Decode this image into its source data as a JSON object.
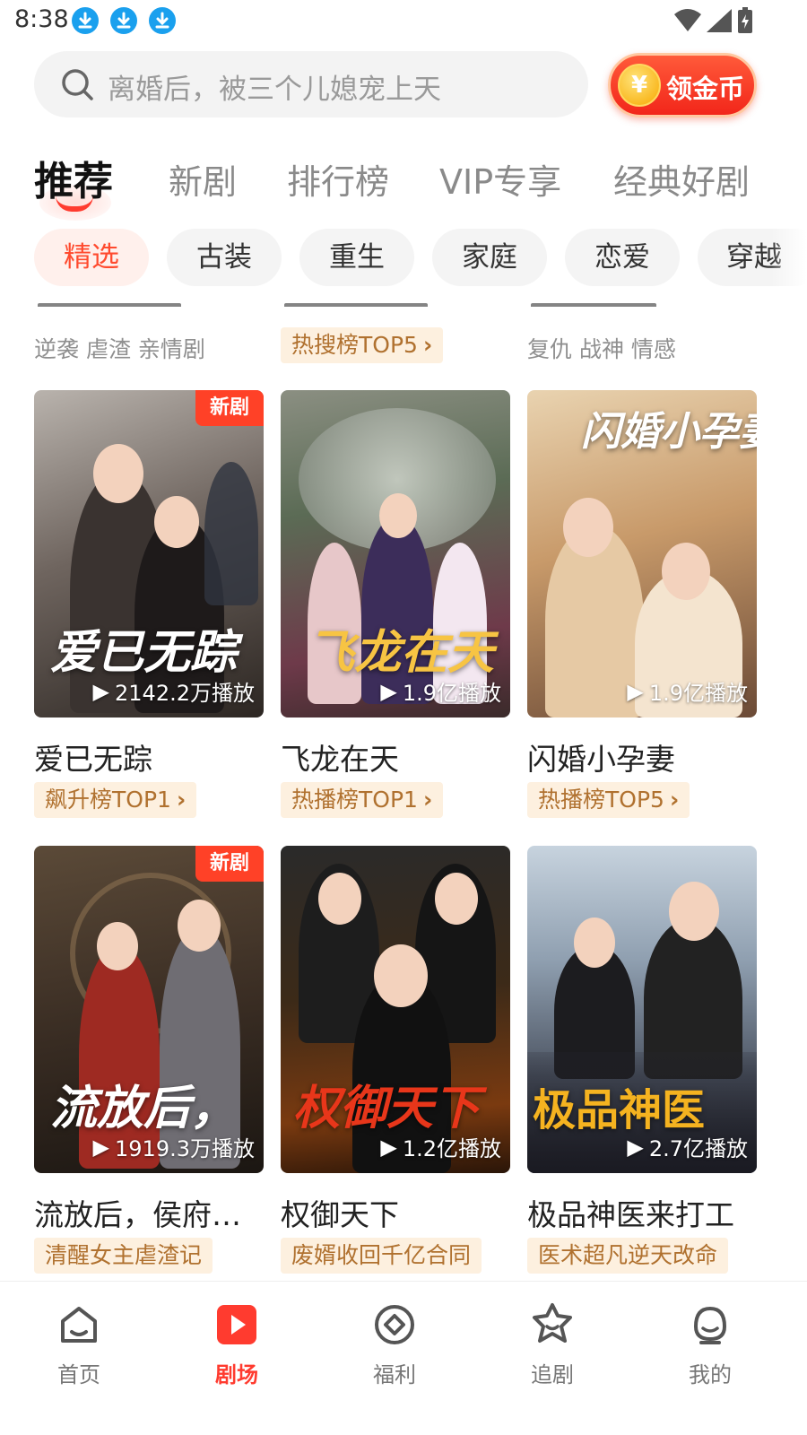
{
  "status_bar": {
    "time": "8:38"
  },
  "search": {
    "placeholder": "离婚后，被三个儿媳宠上天",
    "coin_button_label": "领金币",
    "coin_symbol": "¥"
  },
  "main_tabs": [
    {
      "label": "推荐",
      "active": true
    },
    {
      "label": "新剧"
    },
    {
      "label": "排行榜"
    },
    {
      "label": "VIP专享"
    },
    {
      "label": "经典好剧"
    }
  ],
  "chips": [
    {
      "label": "精选",
      "active": true
    },
    {
      "label": "古装"
    },
    {
      "label": "重生"
    },
    {
      "label": "家庭"
    },
    {
      "label": "恋爱"
    },
    {
      "label": "穿越"
    }
  ],
  "partial_row": [
    {
      "tags": "逆袭 虐渣 亲情剧"
    },
    {
      "rank_tag": "热搜榜TOP5"
    },
    {
      "tags": "复仇 战神 情感"
    }
  ],
  "cards": [
    {
      "title": "爱已无踪",
      "plays": "2142.2万播放",
      "badge": "新剧",
      "rank_tag": "飙升榜TOP1",
      "poster_text": "爱已无踪"
    },
    {
      "title": "飞龙在天",
      "plays": "1.9亿播放",
      "rank_tag": "热播榜TOP1",
      "poster_text": "飞龙在天"
    },
    {
      "title": "闪婚小孕妻",
      "plays": "1.9亿播放",
      "rank_tag": "热播榜TOP5",
      "poster_text": "闪婚小孕妻"
    },
    {
      "title": "流放后，侯府…",
      "plays": "1919.3万播放",
      "badge": "新剧",
      "rank_tag": "清醒女主虐渣记",
      "poster_text": "流放后，"
    },
    {
      "title": "权御天下",
      "plays": "1.2亿播放",
      "rank_tag": "废婿收回千亿合同",
      "poster_text": "权御天下"
    },
    {
      "title": "极品神医来打工",
      "plays": "2.7亿播放",
      "rank_tag": "医术超凡逆天改命",
      "poster_text": "极品神医"
    }
  ],
  "bottom_nav": [
    {
      "label": "首页",
      "icon": "home-icon"
    },
    {
      "label": "剧场",
      "icon": "theater-play-icon",
      "active": true
    },
    {
      "label": "福利",
      "icon": "welfare-icon"
    },
    {
      "label": "追剧",
      "icon": "follow-icon"
    },
    {
      "label": "我的",
      "icon": "profile-icon"
    }
  ],
  "colors": {
    "accent": "#ff3b2f",
    "rank_tag_bg": "#fdf0df",
    "rank_tag_text": "#b0712f",
    "chip_active_bg": "#fff0ec",
    "chip_active_text": "#ff4a2e"
  }
}
